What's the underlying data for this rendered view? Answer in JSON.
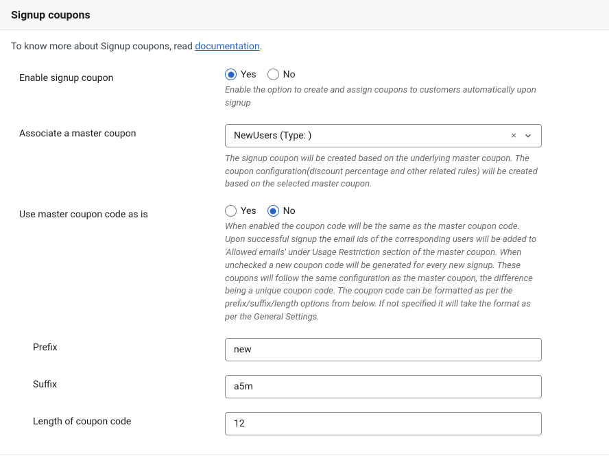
{
  "header": {
    "title": "Signup coupons"
  },
  "intro": {
    "prefix": "To know more about Signup coupons, read ",
    "link": "documentation",
    "suffix": "."
  },
  "fields": {
    "enable": {
      "label": "Enable signup coupon",
      "yes": "Yes",
      "no": "No",
      "help": "Enable the option to create and assign coupons to customers automatically upon signup"
    },
    "associate": {
      "label": "Associate a master coupon",
      "selected": "NewUsers (Type: )",
      "help": "The signup coupon will be created based on the underlying master coupon. The coupon configuration(discount percentage and other related rules) will be created based on the selected master coupon."
    },
    "asis": {
      "label": "Use master coupon code as is",
      "yes": "Yes",
      "no": "No",
      "help": "When enabled the coupon code will be the same as the master coupon code. Upon successful signup the email ids of the corresponding users will be added to 'Allowed emails' under Usage Restriction section of the master coupon. When unchecked a new coupon code will be generated for every new signup. These coupons will follow the same configuration as the master coupon, the difference being a unique coupon code. The coupon code can be formatted as per the prefix/suffix/length options from below. If not specified it will take the format as per the General Settings."
    },
    "prefix": {
      "label": "Prefix",
      "value": "new"
    },
    "suffix": {
      "label": "Suffix",
      "value": "a5m"
    },
    "length": {
      "label": "Length of coupon code",
      "value": "12"
    }
  }
}
